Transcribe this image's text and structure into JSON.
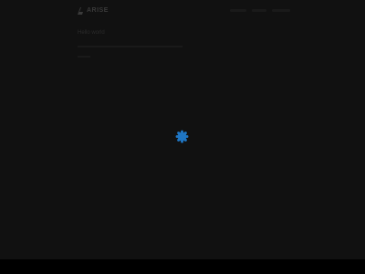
{
  "header": {
    "logo": {
      "word": "ARISE",
      "sub": "",
      "icon": "logo-mark-icon"
    }
  },
  "main": {
    "title": "Hello world"
  },
  "loader": {
    "icon": "loading-spinner-icon",
    "color": "#1f76c4"
  },
  "colors": {
    "background": "#111111",
    "bottom_bar": "#000000"
  }
}
